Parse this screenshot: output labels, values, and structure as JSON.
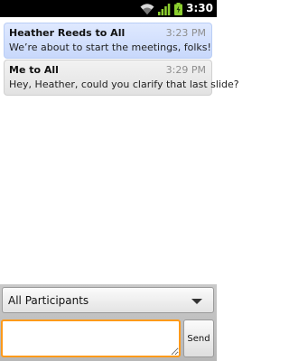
{
  "status_bar": {
    "time": "3:30",
    "icons": [
      "wifi-icon",
      "signal-icon",
      "battery-icon"
    ]
  },
  "messages": [
    {
      "sender": "Heather Reeds to All",
      "time": "3:23 PM",
      "text": "We’re about to start the meetings, folks!",
      "highlighted": true
    },
    {
      "sender": "Me to All",
      "time": "3:29 PM",
      "text": "Hey, Heather, could you clarify that last slide?",
      "highlighted": false
    }
  ],
  "composer": {
    "recipient_selected": "All Participants",
    "input_value": "",
    "input_placeholder": "",
    "send_label": "Send"
  },
  "colors": {
    "highlight_bubble": "#c8d8fb",
    "input_focus_border": "#ff9a1a",
    "status_bar_bg": "#000000"
  }
}
